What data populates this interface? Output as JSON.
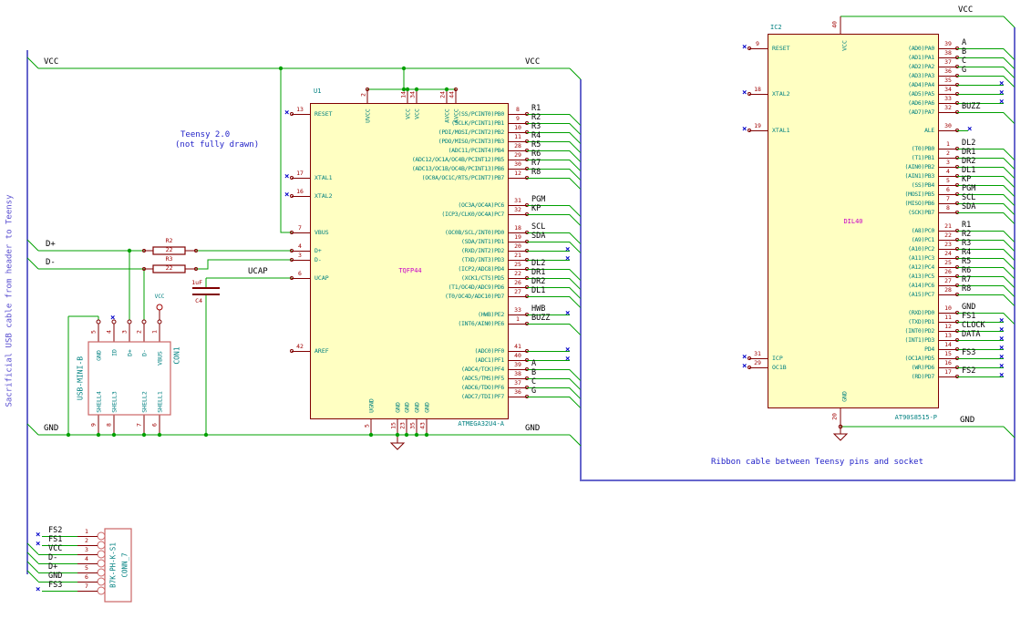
{
  "notes": {
    "teensy1": "Teensy 2.0",
    "teensy2": "(not fully drawn)",
    "usb_cable": "Sacrificial USB cable from header to Teensy",
    "ribbon": "Ribbon cable between Teensy pins and socket"
  },
  "nets": {
    "vcc": "VCC",
    "gnd": "GND",
    "dplus": "D+",
    "dminus": "D-",
    "ucap": "UCAP"
  },
  "colors": {
    "wire": "#00A000",
    "bus": "#6666CC",
    "pin": "#800000",
    "pin_name": "#008080",
    "pin_number": "#A00000",
    "no_connect": "#0000C8",
    "value": "#C800C8",
    "body_fill": "#FFFFC2",
    "note": "#2222C8"
  },
  "u1": {
    "ref": "U1",
    "value": "TQFP44",
    "part": "ATMEGA32U4-A",
    "right_rows": [
      {
        "num": "8",
        "name": "(SS/PCINT0)PB0",
        "label": "R1",
        "conn": "bus"
      },
      {
        "num": "9",
        "name": "(SCLK/PCINT1)PB1",
        "label": "R2",
        "conn": "bus"
      },
      {
        "num": "10",
        "name": "(PDI/MOSI/PCINT2)PB2",
        "label": "R3",
        "conn": "bus"
      },
      {
        "num": "11",
        "name": "(PDO/MISO/PCINT3)PB3",
        "label": "R4",
        "conn": "bus"
      },
      {
        "num": "28",
        "name": "(ADC11/PCINT4)PB4",
        "label": "R5",
        "conn": "bus"
      },
      {
        "num": "29",
        "name": "(ADC12/OC1A/OC4B/PCINT12)PB5",
        "label": "R6",
        "conn": "bus"
      },
      {
        "num": "30",
        "name": "(ADC13/OC1B/OC4B/PCINT13)PB6",
        "label": "R7",
        "conn": "bus"
      },
      {
        "num": "12",
        "name": "(OC0A/OC1C/RTS/PCINT7)PB7",
        "label": "R8",
        "conn": "bus"
      },
      {
        "conn": "spacer"
      },
      {
        "conn": "spacer"
      },
      {
        "num": "31",
        "name": "(OC3A/OC4A)PC6",
        "label": "PGM",
        "conn": "bus"
      },
      {
        "num": "32",
        "name": "(ICP3/CLK0/OC4A)PC7",
        "label": "KP",
        "conn": "bus"
      },
      {
        "conn": "spacer"
      },
      {
        "num": "18",
        "name": "(OC0B/SCL/INT0)PD0",
        "label": "SCL",
        "conn": "bus"
      },
      {
        "num": "19",
        "name": "(SDA/INT1)PD1",
        "label": "SDA",
        "conn": "bus"
      },
      {
        "num": "20",
        "name": "(RXD/INT2)PD2",
        "label": "",
        "conn": "nc"
      },
      {
        "num": "21",
        "name": "(TXD/INT3)PD3",
        "label": "",
        "conn": "nc"
      },
      {
        "num": "25",
        "name": "(ICP2/ADC8)PD4",
        "label": "DL2",
        "conn": "bus"
      },
      {
        "num": "22",
        "name": "(XCK1/CTS)PD5",
        "label": "DR1",
        "conn": "bus"
      },
      {
        "num": "26",
        "name": "(T1/OC4D/ADC9)PD6",
        "label": "DR2",
        "conn": "bus"
      },
      {
        "num": "27",
        "name": "(T0/OC4D/ADC10)PD7",
        "label": "DL1",
        "conn": "bus"
      },
      {
        "conn": "spacer"
      },
      {
        "num": "33",
        "name": "(HWB)PE2",
        "label": "HWB",
        "conn": "nc"
      },
      {
        "num": "1",
        "name": "(INT6/AIN0)PE6",
        "label": "BUZZ",
        "conn": "bus"
      },
      {
        "conn": "spacer"
      },
      {
        "conn": "spacer"
      },
      {
        "num": "41",
        "name": "(ADC0)PF0",
        "label": "",
        "conn": "nc"
      },
      {
        "num": "40",
        "name": "(ADC1)PF1",
        "label": "",
        "conn": "nc"
      },
      {
        "num": "39",
        "name": "(ADC4/TCK)PF4",
        "label": "A",
        "conn": "bus"
      },
      {
        "num": "38",
        "name": "(ADC5/TMS)PF5",
        "label": "B",
        "conn": "bus"
      },
      {
        "num": "37",
        "name": "(ADC6/TDO)PF6",
        "label": "C",
        "conn": "bus"
      },
      {
        "num": "36",
        "name": "(ADC7/TDI)PF7",
        "label": "G",
        "conn": "bus"
      }
    ],
    "left_pins": [
      {
        "num": "13",
        "name": "RESET"
      },
      {
        "num": "17",
        "name": "XTAL1"
      },
      {
        "num": "16",
        "name": "XTAL2"
      },
      {
        "num": "7",
        "name": "VBUS"
      },
      {
        "num": "4",
        "name": "D+"
      },
      {
        "num": "3",
        "name": "D-"
      },
      {
        "num": "6",
        "name": "UCAP"
      },
      {
        "num": "42",
        "name": "AREF"
      }
    ],
    "top_pins": [
      {
        "num": "2",
        "name": "UVCC"
      },
      {
        "num": "14",
        "name": "VCC"
      },
      {
        "num": "34",
        "name": "VCC"
      },
      {
        "num": "24",
        "name": "AVCC"
      },
      {
        "num": "44",
        "name": "AVCC"
      }
    ],
    "bottom_pins": [
      {
        "num": "5",
        "name": "UGND"
      },
      {
        "num": "15",
        "name": "GND"
      },
      {
        "num": "23",
        "name": "GND"
      },
      {
        "num": "35",
        "name": "GND"
      },
      {
        "num": "43",
        "name": "GND"
      }
    ]
  },
  "ic2": {
    "ref": "IC2",
    "value": "DIL40",
    "part": "AT90S8515-P",
    "top_pin": {
      "num": "40",
      "name": "VCC"
    },
    "bottom_pin": {
      "num": "20",
      "name": "GND"
    },
    "left_pins": [
      {
        "num": "9",
        "name": "RESET"
      },
      {
        "num": "18",
        "name": "XTAL2"
      },
      {
        "num": "19",
        "name": "XTAL1"
      },
      {
        "num": "31",
        "name": "ICP"
      },
      {
        "num": "29",
        "name": "OC1B"
      }
    ],
    "right_rows": [
      {
        "num": "39",
        "name": "(AD0)PA0",
        "label": "A",
        "conn": "bus"
      },
      {
        "num": "38",
        "name": "(AD1)PA1",
        "label": "B",
        "conn": "bus"
      },
      {
        "num": "37",
        "name": "(AD2)PA2",
        "label": "C",
        "conn": "bus"
      },
      {
        "num": "36",
        "name": "(AD3)PA3",
        "label": "G",
        "conn": "bus"
      },
      {
        "num": "35",
        "name": "(AD4)PA4",
        "label": "",
        "conn": "nc"
      },
      {
        "num": "34",
        "name": "(AD5)PA5",
        "label": "",
        "conn": "nc"
      },
      {
        "num": "33",
        "name": "(AD6)PA6",
        "label": "",
        "conn": "nc"
      },
      {
        "num": "32",
        "name": "(AD7)PA7",
        "label": "BUZZ",
        "conn": "bus"
      },
      {
        "conn": "spacer"
      },
      {
        "num": "30",
        "name": "ALE",
        "label": "",
        "conn": "nc-short"
      },
      {
        "conn": "spacer"
      },
      {
        "num": "1",
        "name": "(T0)PB0",
        "label": "DL2",
        "conn": "bus"
      },
      {
        "num": "2",
        "name": "(T1)PB1",
        "label": "DR1",
        "conn": "bus"
      },
      {
        "num": "3",
        "name": "(AIN0)PB2",
        "label": "DR2",
        "conn": "bus"
      },
      {
        "num": "4",
        "name": "(AIN1)PB3",
        "label": "DL1",
        "conn": "bus"
      },
      {
        "num": "5",
        "name": "(SS)PB4",
        "label": "KP",
        "conn": "bus"
      },
      {
        "num": "6",
        "name": "(MOSI)PB5",
        "label": "PGM",
        "conn": "bus"
      },
      {
        "num": "7",
        "name": "(MISO)PB6",
        "label": "SCL",
        "conn": "bus"
      },
      {
        "num": "8",
        "name": "(SCK)PB7",
        "label": "SDA",
        "conn": "bus"
      },
      {
        "conn": "spacer"
      },
      {
        "num": "21",
        "name": "(A8)PC0",
        "label": "R1",
        "conn": "bus"
      },
      {
        "num": "22",
        "name": "(A9)PC1",
        "label": "R2",
        "conn": "bus"
      },
      {
        "num": "23",
        "name": "(A10)PC2",
        "label": "R3",
        "conn": "bus"
      },
      {
        "num": "24",
        "name": "(A11)PC3",
        "label": "R4",
        "conn": "bus"
      },
      {
        "num": "25",
        "name": "(A12)PC4",
        "label": "R5",
        "conn": "bus"
      },
      {
        "num": "26",
        "name": "(A13)PC5",
        "label": "R6",
        "conn": "bus"
      },
      {
        "num": "27",
        "name": "(A14)PC6",
        "label": "R7",
        "conn": "bus"
      },
      {
        "num": "28",
        "name": "(A15)PC7",
        "label": "R8",
        "conn": "bus"
      },
      {
        "conn": "spacer"
      },
      {
        "num": "10",
        "name": "(RXD)PD0",
        "label": "GND",
        "conn": "bus"
      },
      {
        "num": "11",
        "name": "(TXD)PD1",
        "label": "FS1",
        "conn": "nc"
      },
      {
        "num": "12",
        "name": "(INT0)PD2",
        "label": "CLOCK",
        "conn": "nc"
      },
      {
        "num": "13",
        "name": "(INT1)PD3",
        "label": "DATA",
        "conn": "nc"
      },
      {
        "num": "14",
        "name": "PD4",
        "label": "",
        "conn": "nc"
      },
      {
        "num": "15",
        "name": "(OC1A)PD5",
        "label": "FS3",
        "conn": "nc"
      },
      {
        "num": "16",
        "name": "(WR)PD6",
        "label": "",
        "conn": "nc"
      },
      {
        "num": "17",
        "name": "(RD)PD7",
        "label": "FS2",
        "conn": "nc"
      }
    ]
  },
  "con1": {
    "ref": "CON1",
    "value": "USB-MINI-B",
    "top_pins": [
      {
        "num": "5",
        "name": "GND"
      },
      {
        "num": "4",
        "name": "ID"
      },
      {
        "num": "3",
        "name": "D+"
      },
      {
        "num": "2",
        "name": "D-"
      },
      {
        "num": "1",
        "name": "VBUS"
      }
    ],
    "bottom_pins": [
      {
        "num": "9",
        "name": "SHELL4"
      },
      {
        "num": "8",
        "name": "SHELL3"
      },
      {
        "num": "7",
        "name": "SHELL2"
      },
      {
        "num": "6",
        "name": "SHELL1"
      }
    ],
    "vcc_symbol": "VCC"
  },
  "conn7": {
    "ref": "CONN_7",
    "value": "B7K-PH-K-S1",
    "rows": [
      {
        "num": "1",
        "label": "FS2",
        "conn": "nc"
      },
      {
        "num": "2",
        "label": "FS1",
        "conn": "nc"
      },
      {
        "num": "3",
        "label": "VCC",
        "conn": "bus"
      },
      {
        "num": "4",
        "label": "D-",
        "conn": "bus"
      },
      {
        "num": "5",
        "label": "D+",
        "conn": "bus"
      },
      {
        "num": "6",
        "label": "GND",
        "conn": "bus"
      },
      {
        "num": "7",
        "label": "FS3",
        "conn": "nc"
      }
    ]
  },
  "r2": {
    "ref": "R2",
    "value": "22"
  },
  "r3": {
    "ref": "R3",
    "value": "22"
  },
  "c4": {
    "ref": "C4",
    "value": "1uF"
  }
}
